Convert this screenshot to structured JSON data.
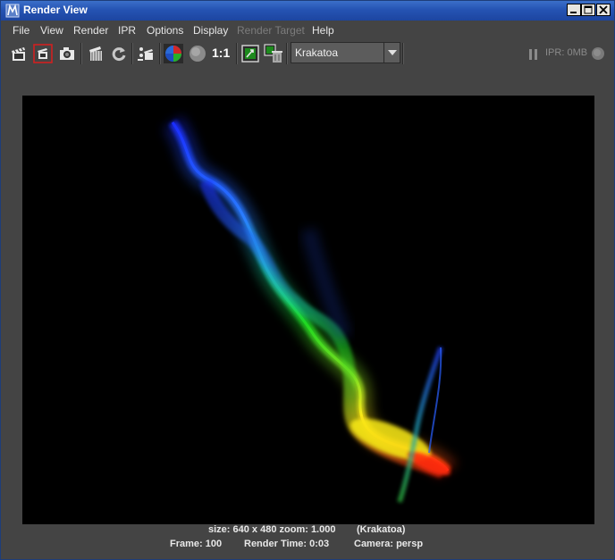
{
  "window": {
    "title": "Render View",
    "controls": [
      "minimize",
      "maximize",
      "close"
    ]
  },
  "menu": [
    {
      "label": "File",
      "enabled": true
    },
    {
      "label": "View",
      "enabled": true
    },
    {
      "label": "Render",
      "enabled": true
    },
    {
      "label": "IPR",
      "enabled": true
    },
    {
      "label": "Options",
      "enabled": true
    },
    {
      "label": "Display",
      "enabled": true
    },
    {
      "label": "Render Target",
      "enabled": false
    },
    {
      "label": "Help",
      "enabled": true
    }
  ],
  "toolbar": {
    "buttons": [
      "redo-render-icon",
      "render-region-icon",
      "snapshot-icon",
      "ipr-render-icon",
      "refresh-ipr-icon",
      "render-settings-icon",
      "display-rgb-icon",
      "display-alpha-icon",
      "zoom-actual-size",
      "keep-image-icon",
      "remove-image-icon"
    ],
    "zoom_label": "1:1",
    "renderer_dropdown": "Krakatoa",
    "ipr_status": "IPR: 0MB"
  },
  "render_info": {
    "size_zoom": "size: 640 x 480 zoom: 1.000",
    "renderer": "(Krakatoa)",
    "frame": "Frame: 100",
    "render_time": "Render Time: 0:03",
    "camera": "Camera: persp"
  },
  "colors": {
    "titlebar": "#2553b3",
    "background": "#444444",
    "render_background": "#000000",
    "particle_blue": "#2040ff",
    "particle_green": "#20d020",
    "particle_yellow": "#f0e020",
    "particle_red": "#ff2a10"
  }
}
